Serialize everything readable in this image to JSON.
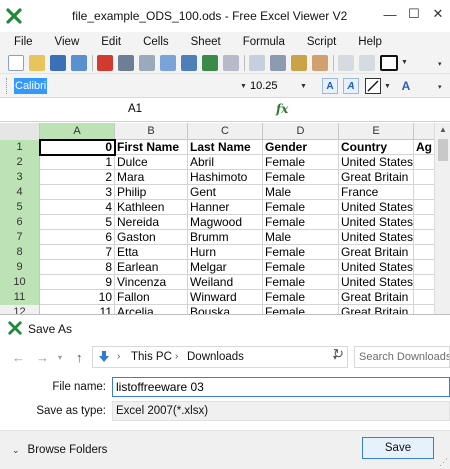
{
  "window": {
    "title": "file_example_ODS_100.ods - Free Excel Viewer V2",
    "minimize": "—",
    "maximize": "☐",
    "close": "✕"
  },
  "menu": [
    "File",
    "View",
    "Edit",
    "Cells",
    "Sheet",
    "Formula",
    "Script",
    "Help"
  ],
  "format_bar": {
    "font_name": "Calibri",
    "font_size": "10.25",
    "bold_label": "A",
    "italic_label": "A",
    "color_label": "A"
  },
  "formula_bar": {
    "cell_ref": "A1",
    "fx": "fx"
  },
  "sheet": {
    "columns": [
      "A",
      "B",
      "C",
      "D",
      "E",
      ""
    ],
    "rows": [
      {
        "n": "1",
        "cells": [
          "0",
          "First Name",
          "Last Name",
          "Gender",
          "Country",
          "Ag"
        ]
      },
      {
        "n": "2",
        "cells": [
          "1",
          "Dulce",
          "Abril",
          "Female",
          "United States",
          ""
        ]
      },
      {
        "n": "3",
        "cells": [
          "2",
          "Mara",
          "Hashimoto",
          "Female",
          "Great Britain",
          ""
        ]
      },
      {
        "n": "4",
        "cells": [
          "3",
          "Philip",
          "Gent",
          "Male",
          "France",
          ""
        ]
      },
      {
        "n": "5",
        "cells": [
          "4",
          "Kathleen",
          "Hanner",
          "Female",
          "United States",
          ""
        ]
      },
      {
        "n": "6",
        "cells": [
          "5",
          "Nereida",
          "Magwood",
          "Female",
          "United States",
          ""
        ]
      },
      {
        "n": "7",
        "cells": [
          "6",
          "Gaston",
          "Brumm",
          "Male",
          "United States",
          ""
        ]
      },
      {
        "n": "8",
        "cells": [
          "7",
          "Etta",
          "Hurn",
          "Female",
          "Great Britain",
          ""
        ]
      },
      {
        "n": "9",
        "cells": [
          "8",
          "Earlean",
          "Melgar",
          "Female",
          "United States",
          ""
        ]
      },
      {
        "n": "10",
        "cells": [
          "9",
          "Vincenza",
          "Weiland",
          "Female",
          "United States",
          ""
        ]
      },
      {
        "n": "11",
        "cells": [
          "10",
          "Fallon",
          "Winward",
          "Female",
          "Great Britain",
          ""
        ]
      },
      {
        "n": "12",
        "cells": [
          "11",
          "Arcelia",
          "Bouska",
          "Female",
          "Great Britain",
          ""
        ]
      }
    ]
  },
  "save_dialog": {
    "title": "Save As",
    "path": [
      "This PC",
      "Downloads"
    ],
    "search_placeholder": "Search Downloads",
    "file_name_label": "File name:",
    "file_name_value": "listoffreeware 03",
    "save_type_label": "Save as type:",
    "save_type_value": "Excel 2007(*.xlsx)",
    "browse_label": "Browse Folders",
    "save_button": "Save"
  },
  "colors": {
    "accent": "#3c7fd1",
    "selected_header": "#bde2b5",
    "selection": "#3399ff"
  }
}
